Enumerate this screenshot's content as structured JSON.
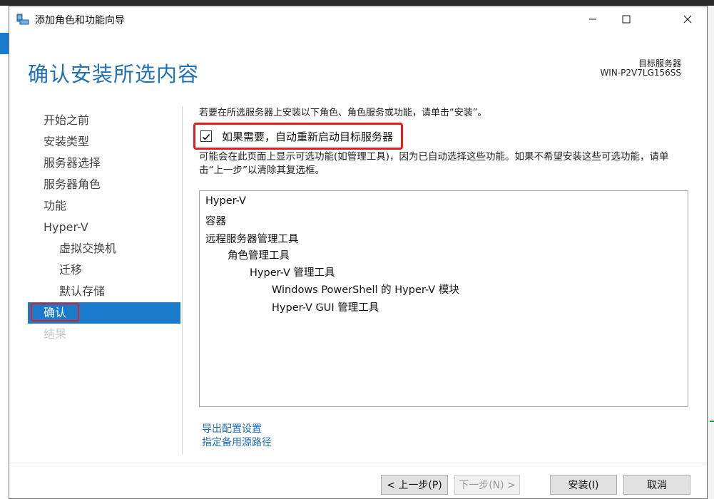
{
  "window": {
    "title": "添加角色和功能向导",
    "icon": "server-manager-icon"
  },
  "header": {
    "title": "确认安装所选内容",
    "target_label": "目标服务器",
    "target_name": "WIN-P2V7LG156SS"
  },
  "nav": {
    "items": [
      {
        "label": "开始之前",
        "state": "normal"
      },
      {
        "label": "安装类型",
        "state": "normal"
      },
      {
        "label": "服务器选择",
        "state": "normal"
      },
      {
        "label": "服务器角色",
        "state": "normal"
      },
      {
        "label": "功能",
        "state": "normal"
      },
      {
        "label": "Hyper-V",
        "state": "normal"
      },
      {
        "label": "虚拟交换机",
        "state": "normal"
      },
      {
        "label": "迁移",
        "state": "normal"
      },
      {
        "label": "默认存储",
        "state": "normal"
      },
      {
        "label": "确认",
        "state": "active"
      },
      {
        "label": "结果",
        "state": "disabled"
      }
    ]
  },
  "content": {
    "intro": "若要在所选服务器上安装以下角色、角色服务或功能，请单击“安装”。",
    "restart_checkbox": {
      "label": "如果需要，自动重新启动目标服务器",
      "checked": true
    },
    "note": "可能会在此页面上显示可选功能(如管理工具)，因为已自动选择这些功能。如果不希望安装这些可选功能，请单击“上一步”以清除其复选框。",
    "selection": [
      {
        "label": "Hyper-V",
        "level": 0
      },
      {
        "label": "容器",
        "level": 0
      },
      {
        "label": "远程服务器管理工具",
        "level": 0
      },
      {
        "label": "角色管理工具",
        "level": 1
      },
      {
        "label": "Hyper-V 管理工具",
        "level": 2
      },
      {
        "label": "Windows PowerShell 的 Hyper-V 模块",
        "level": 3
      },
      {
        "label": "Hyper-V GUI 管理工具",
        "level": 3
      }
    ],
    "links": {
      "export": "导出配置设置",
      "alt_source": "指定备用源路径"
    }
  },
  "buttons": {
    "previous": "< 上一步(P)",
    "next": "下一步(N) >",
    "install": "安装(I)",
    "cancel": "取消"
  },
  "colors": {
    "accent": "#1979ca",
    "title_blue": "#1f72b8",
    "highlight_red": "#e41e1e",
    "link": "#1f6fb5"
  }
}
